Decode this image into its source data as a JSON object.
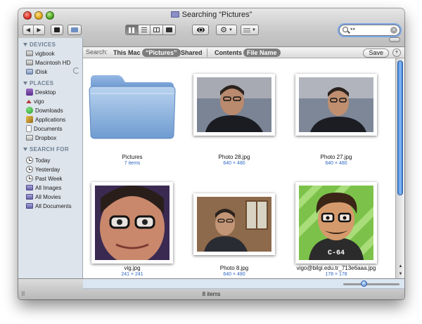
{
  "window": {
    "title": "Searching “Pictures”"
  },
  "toolbar": {
    "back_label": "◀",
    "forward_label": "▶",
    "search_value": "**"
  },
  "scope_bar": {
    "label": "Search:",
    "locations": [
      "This Mac",
      "“Pictures”",
      "Shared"
    ],
    "selected_location": "“Pictures”",
    "criteria": [
      "Contents",
      "File Name"
    ],
    "selected_criterion": "File Name",
    "save_label": "Save",
    "add_label": "+"
  },
  "sidebar": {
    "devices_header": "DEVICES",
    "devices": [
      "vigbook",
      "Macintosh HD",
      "iDisk"
    ],
    "places_header": "PLACES",
    "places": [
      "Desktop",
      "vigo",
      "Downloads",
      "Applications",
      "Documents",
      "Dropbox"
    ],
    "search_header": "SEARCH FOR",
    "searches": [
      "Today",
      "Yesterday",
      "Past Week",
      "All Images",
      "All Movies",
      "All Documents"
    ]
  },
  "items": [
    {
      "name": "Pictures",
      "info": "7 items"
    },
    {
      "name": "Photo 28.jpg",
      "info": "640 × 480"
    },
    {
      "name": "Photo 27.jpg",
      "info": "640 × 480"
    },
    {
      "name": "vig.jpg",
      "info": "241 × 241"
    },
    {
      "name": "Photo 8.jpg",
      "info": "640 × 480"
    },
    {
      "name": "vigo@bilgi.edu.tr_713e6aaa.jpg",
      "info": "178 × 178"
    }
  ],
  "status": {
    "text": "8 items"
  },
  "colors": {
    "accent": "#3f7fd8",
    "sidebar_bg": "#dde4ec",
    "info_blue": "#2f67c3"
  }
}
